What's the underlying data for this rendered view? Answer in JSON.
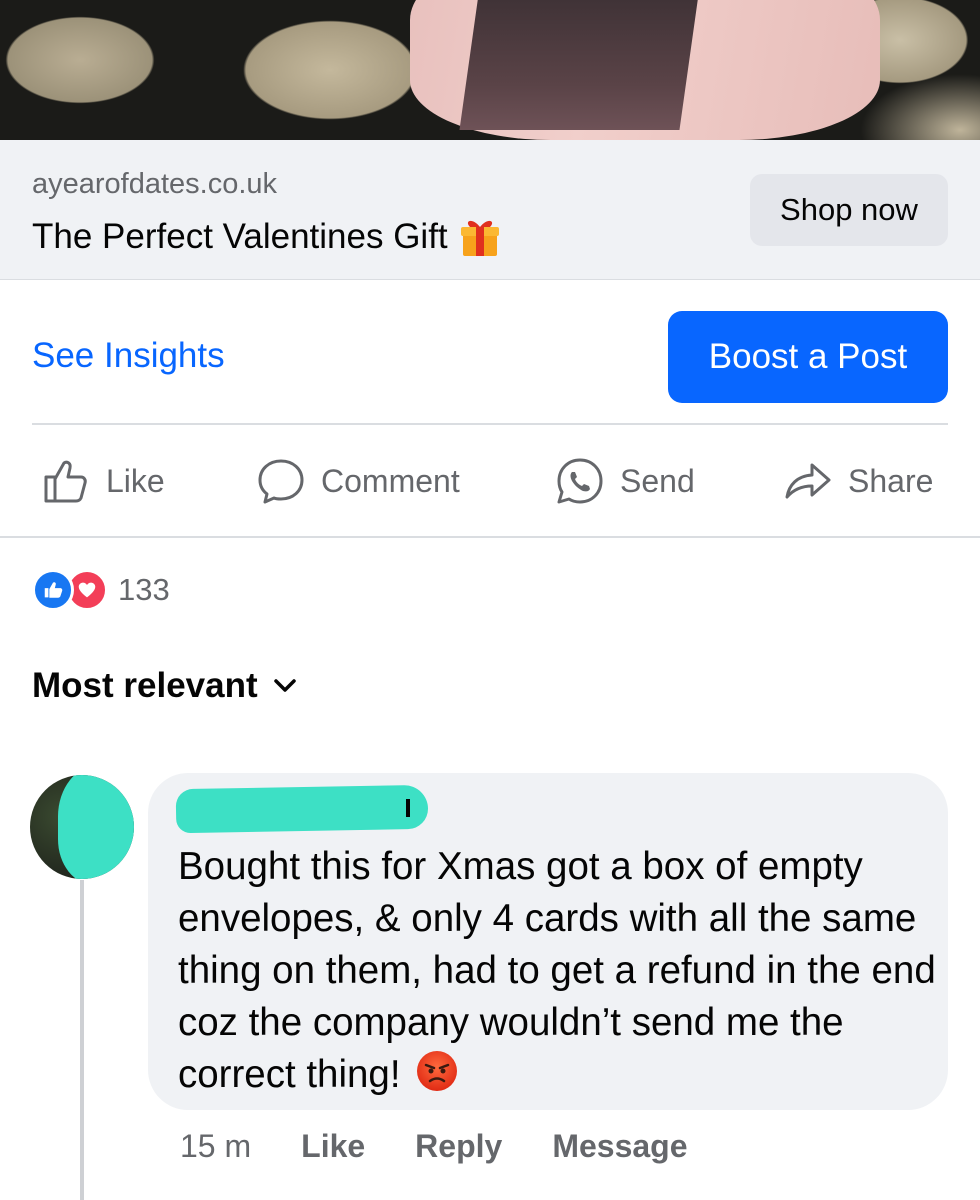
{
  "link_preview": {
    "domain": "ayearofdates.co.uk",
    "title": "The Perfect Valentines Gift",
    "title_icon": "gift-icon",
    "cta_label": "Shop now"
  },
  "insights": {
    "see_insights_label": "See Insights",
    "boost_label": "Boost a Post"
  },
  "actions": {
    "like": "Like",
    "comment": "Comment",
    "send": "Send",
    "share": "Share"
  },
  "reactions": {
    "types": [
      "like",
      "love"
    ],
    "count": "133"
  },
  "sort": {
    "label": "Most relevant"
  },
  "comment": {
    "text": "Bought this for Xmas got a box of empty envelopes, & only 4 cards with all the same thing on them, had to get a refund in the end coz the company wouldn’t send me the correct thing!",
    "emoji": "angry-face-icon",
    "time": "15 m",
    "like_label": "Like",
    "reply_label": "Reply",
    "message_label": "Message"
  },
  "colors": {
    "accent": "#0866ff",
    "muted_text": "#65676b",
    "bubble_bg": "#f0f2f5",
    "redaction": "#3de0c5"
  }
}
